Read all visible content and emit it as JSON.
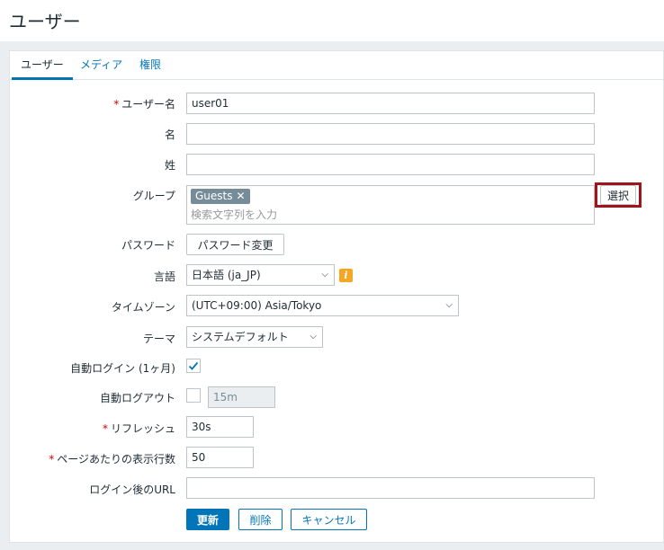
{
  "page": {
    "title": "ユーザー"
  },
  "tabs": [
    {
      "label": "ユーザー",
      "active": true
    },
    {
      "label": "メディア",
      "active": false
    },
    {
      "label": "権限",
      "active": false
    }
  ],
  "form": {
    "username": {
      "label": "ユーザー名",
      "value": "user01",
      "required": true
    },
    "first_name": {
      "label": "名",
      "value": ""
    },
    "last_name": {
      "label": "姓",
      "value": ""
    },
    "groups": {
      "label": "グループ",
      "tags": [
        "Guests"
      ],
      "placeholder": "検索文字列を入力",
      "select_label": "選択"
    },
    "password": {
      "label": "パスワード",
      "button_label": "パスワード変更"
    },
    "language": {
      "label": "言語",
      "value": "日本語 (ja_JP)",
      "info_glyph": "i"
    },
    "timezone": {
      "label": "タイムゾーン",
      "value": "(UTC+09:00) Asia/Tokyo"
    },
    "theme": {
      "label": "テーマ",
      "value": "システムデフォルト"
    },
    "autologin": {
      "label": "自動ログイン (1ヶ月)",
      "checked": true
    },
    "autologout": {
      "label": "自動ログアウト",
      "checked": false,
      "value": "15m"
    },
    "refresh": {
      "label": "リフレッシュ",
      "value": "30s",
      "required": true
    },
    "rows_per_page": {
      "label": "ページあたりの表示行数",
      "value": "50",
      "required": true
    },
    "url": {
      "label": "ログイン後のURL",
      "value": ""
    }
  },
  "actions": {
    "update": "更新",
    "delete": "削除",
    "cancel": "キャンセル"
  },
  "required_mark": "*",
  "colors": {
    "accent": "#0275b8",
    "tag_bg": "#768d99",
    "required": "#d40000",
    "highlight": "#a3131b",
    "info": "#f5a623"
  }
}
